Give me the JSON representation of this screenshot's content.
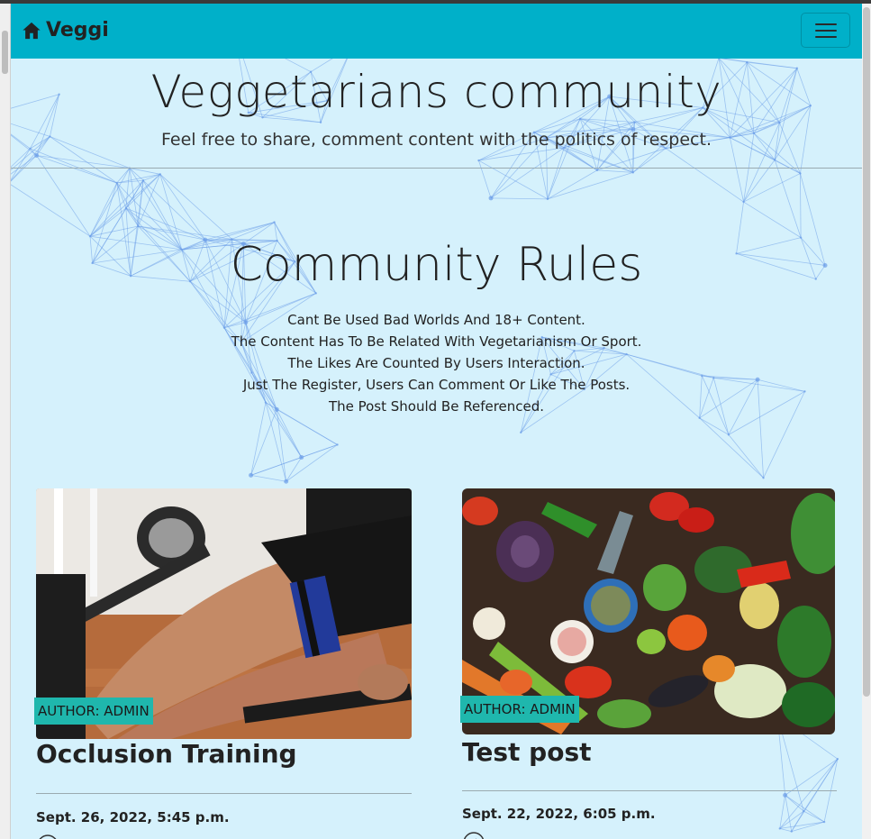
{
  "nav": {
    "brand": "Veggi",
    "brand_icon": "home-icon",
    "menu_icon": "hamburger-menu-icon"
  },
  "hero": {
    "title": "Veggetarians community",
    "subtitle": "Feel free to share, comment content with the politics of respect."
  },
  "rules": {
    "title": "Community Rules",
    "items": [
      "Cant Be Used Bad Worlds And 18+ Content.",
      "The Content Has To Be Related With Vegetarianism Or Sport.",
      "The Likes Are Counted By Users Interaction.",
      "Just The Register, Users Can Comment Or Like The Posts.",
      "The Post Should Be Referenced."
    ]
  },
  "posts": [
    {
      "author": "AUTHOR: ADMIN",
      "title": "Occlusion Training",
      "date": "Sept. 26, 2022, 5:45 p.m.",
      "image": "leg-press-occlusion-training-photo",
      "like_icon": "like-icon"
    },
    {
      "author": "AUTHOR: ADMIN",
      "title": "Test post",
      "date": "Sept. 22, 2022, 6:05 p.m.",
      "image": "vegetables-on-table-photo",
      "like_icon": "like-icon"
    }
  ],
  "colors": {
    "navbar": "#00b0c9",
    "page_background": "#d5f1fc",
    "author_badge": "#1fb7ad",
    "network_lines": "#6c9ee8"
  }
}
